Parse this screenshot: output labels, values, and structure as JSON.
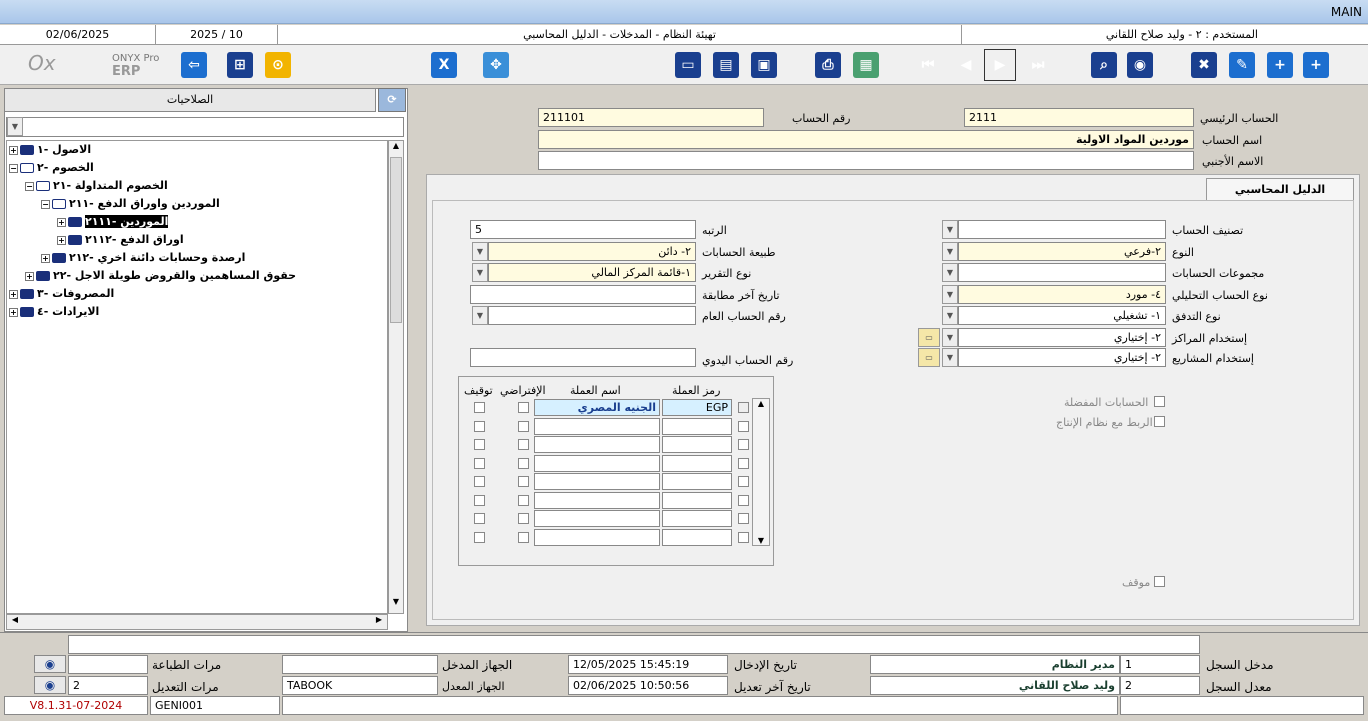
{
  "window": {
    "title": "MAIN"
  },
  "infobar": {
    "date": "02/06/2025",
    "period": "2025 / 10",
    "screen": "تهيئة النظام - المدخلات - الدليل المحاسبي",
    "user": "المستخدم : ٢ - وليد صلاح  اللقاني"
  },
  "logo": {
    "line1": "ONYX Pro",
    "line2": "ERP"
  },
  "tree": {
    "header": "الصلاحيات",
    "nodes": [
      {
        "label": "الاصول -١"
      },
      {
        "label": "الخصوم -٢"
      },
      {
        "label": "الخصوم المتداولة -٢١"
      },
      {
        "label": "الموردين واوراق الدفع -٢١١"
      },
      {
        "label": "الموردين -٢١١١"
      },
      {
        "label": "اوراق الدفع -٢١١٢"
      },
      {
        "label": "ارصدة وحسابات دائنة اخري -٢١٢"
      },
      {
        "label": "حقوق المساهمين والقروض طويلة الاجل -٢٢"
      },
      {
        "label": "المصروفات -٣"
      },
      {
        "label": "الايرادات -٤"
      }
    ]
  },
  "form": {
    "main_account_label": "الحساب الرئيسي",
    "main_account": "2111",
    "account_no_label": "رقم الحساب",
    "account_no": "211101",
    "account_name_label": "اسم الحساب",
    "account_name": "موردين المواد الاولية",
    "foreign_name_label": "الاسم الأجنبي",
    "foreign_name": "",
    "tab_label": "الدليل المحاسبي",
    "classification_label": "تصنيف الحساب",
    "classification": "",
    "type_label": "النوع",
    "type": "٢-فرعي",
    "groups_label": "مجموعات الحسابات",
    "groups": "",
    "analytic_label": "نوع الحساب التحليلي",
    "analytic": "٤- مورد",
    "flow_label": "نوع التدفق",
    "flow": "١- تشغيلي",
    "centers_label": "إستخدام المراكز",
    "centers": "٢- إختياري",
    "projects_label": "إستخدام المشاريع",
    "projects": "٢- إختياري",
    "rank_label": "الرتبه",
    "rank": "5",
    "nature_label": "طبيعة الحسابات",
    "nature": "٢- دائن",
    "report_label": "نوع التقرير",
    "report": "١-قائمة المركز المالي",
    "last_match_label": "تاريخ آخر مطابقة",
    "last_match": "",
    "general_no_label": "رقم الحساب العام",
    "general_no": "",
    "manual_no_label": "رقم الحساب اليدوي",
    "manual_no": "",
    "favorites_label": "الحسابات المفضلة",
    "production_label": "الربط مع نظام الإنتاج",
    "stopped_label": "موقف"
  },
  "currency_grid": {
    "headers": {
      "code": "رمز العملة",
      "name": "اسم العملة",
      "default": "الإفتراضي",
      "stop": "توقيف"
    },
    "rows": [
      {
        "code": "EGP",
        "name": "الجنيه المصري"
      }
    ]
  },
  "footer": {
    "entered_by_label": "مدخل السجل",
    "entered_by_id": "1",
    "entered_by": "مدير النظام",
    "modified_by_label": "معدل السجل",
    "modified_by_id": "2",
    "modified_by": "وليد صلاح  اللقاني",
    "entry_date_label": "تاريخ الإدخال",
    "entry_date": "12/05/2025 15:45:19",
    "modify_date_label": "تاريخ آخر تعديل",
    "modify_date": "02/06/2025 10:50:56",
    "entry_device_label": "الجهاز المدخل",
    "entry_device": "",
    "modify_device_label": "الجهاز المعدل",
    "modify_device": "TABOOK",
    "print_count_label": "مرات الطباعة",
    "print_count": "",
    "modify_count_label": "مرات التعديل",
    "modify_count": "2",
    "version": "V8.1.31-07-2024",
    "screen_code": "GENI001"
  }
}
